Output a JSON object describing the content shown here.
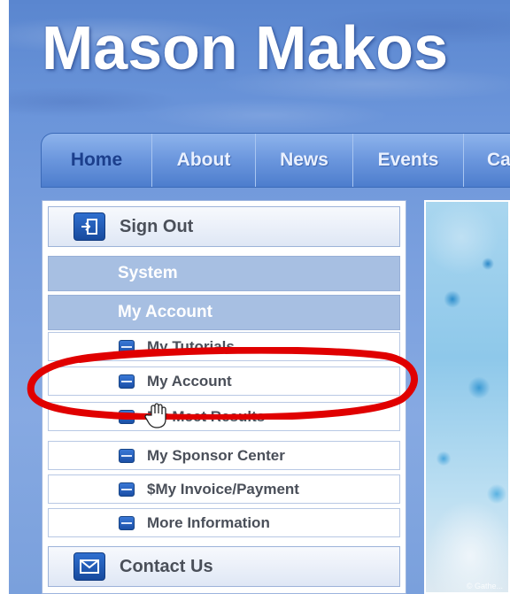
{
  "header": {
    "site_title": "Mason Makos"
  },
  "nav": {
    "items": [
      {
        "label": "Home",
        "active": true
      },
      {
        "label": "About"
      },
      {
        "label": "News"
      },
      {
        "label": "Events"
      },
      {
        "label": "Ca"
      }
    ]
  },
  "sidebar": {
    "sign_out": {
      "label": "Sign Out",
      "icon": "exit-door-icon"
    },
    "section_system": "System",
    "section_my_account": "My Account",
    "items": [
      {
        "label": "My Tutorials"
      },
      {
        "label": "My Account"
      },
      {
        "label": "My Meet Results"
      },
      {
        "label": "My Sponsor Center"
      },
      {
        "label": "$My Invoice/Payment"
      },
      {
        "label": "More Information"
      }
    ],
    "contact": {
      "label": "Contact Us",
      "icon": "envelope-icon"
    }
  },
  "photo": {
    "watermark": "© Gathe..."
  },
  "colors": {
    "nav_active_text": "#1c3f8c",
    "annotation_red": "#e00000",
    "section_header_bg": "#a7bfe2"
  }
}
